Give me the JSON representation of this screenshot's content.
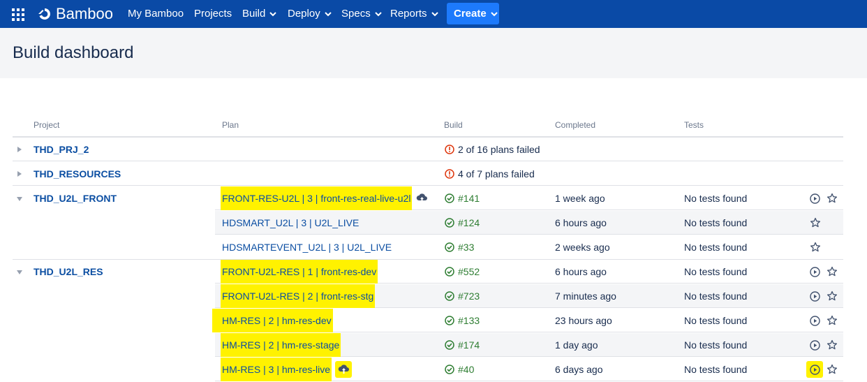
{
  "app": {
    "name": "Bamboo"
  },
  "nav": {
    "items": [
      "My Bamboo",
      "Projects",
      "Build",
      "Deploy",
      "Specs",
      "Reports"
    ],
    "create_label": "Create"
  },
  "page": {
    "title": "Build dashboard"
  },
  "table": {
    "headers": [
      "Project",
      "Plan",
      "Build",
      "Completed",
      "Tests"
    ],
    "projects": [
      {
        "name": "THD_PRJ_2",
        "status": "2 of 16 plans failed"
      },
      {
        "name": "THD_RESOURCES",
        "status": "4 of 7 plans failed"
      },
      {
        "name": "THD_U2L_FRONT"
      },
      {
        "name": "THD_U2L_RES"
      }
    ],
    "plans": [
      {
        "plan": "FRONT-RES-U2L | 3 | front-res-real-live-u2l",
        "build": "#141",
        "completed": "1 week ago",
        "tests": "No tests found"
      },
      {
        "plan": "HDSMART_U2L | 3 | U2L_LIVE",
        "build": "#124",
        "completed": "6 hours ago",
        "tests": "No tests found"
      },
      {
        "plan": "HDSMARTEVENT_U2L | 3 | U2L_LIVE",
        "build": "#33",
        "completed": "2 weeks ago",
        "tests": "No tests found"
      },
      {
        "plan": "FRONT-U2L-RES | 1 | front-res-dev",
        "build": "#552",
        "completed": "6 hours ago",
        "tests": "No tests found"
      },
      {
        "plan": "FRONT-U2L-RES | 2 | front-res-stg",
        "build": "#723",
        "completed": "7 minutes ago",
        "tests": "No tests found"
      },
      {
        "plan": "HM-RES | 2 | hm-res-dev",
        "build": "#133",
        "completed": "23 hours ago",
        "tests": "No tests found"
      },
      {
        "plan": "HM-RES | 2 | hm-res-stage",
        "build": "#174",
        "completed": "1 day ago",
        "tests": "No tests found"
      },
      {
        "plan": "HM-RES | 3 | hm-res-live",
        "build": "#40",
        "completed": "6 days ago",
        "tests": "No tests found"
      }
    ]
  },
  "colors": {
    "nav_bg": "#0a4aa6",
    "create_bg": "#1d7afc",
    "link": "#0b4ea2",
    "success": "#2e7d32",
    "error": "#de350b",
    "highlight": "#fff200"
  }
}
